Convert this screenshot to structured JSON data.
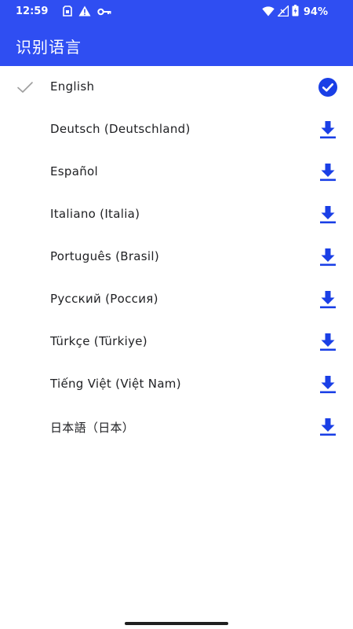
{
  "status_bar": {
    "time": "12:59",
    "left_icons": [
      "sim-icon",
      "warning-icon",
      "vpn-key-icon"
    ],
    "right_icons": [
      "wifi-icon",
      "cell-signal-icon",
      "battery-icon"
    ],
    "battery_percent": "94%"
  },
  "app_bar": {
    "title": "识别语言"
  },
  "languages": [
    {
      "label": "English",
      "selected": true,
      "status": "downloaded",
      "action_icon": "check-circle-icon"
    },
    {
      "label": "Deutsch (Deutschland)",
      "selected": false,
      "status": "available",
      "action_icon": "download-icon"
    },
    {
      "label": "Español",
      "selected": false,
      "status": "available",
      "action_icon": "download-icon"
    },
    {
      "label": "Italiano (Italia)",
      "selected": false,
      "status": "available",
      "action_icon": "download-icon"
    },
    {
      "label": "Português (Brasil)",
      "selected": false,
      "status": "available",
      "action_icon": "download-icon"
    },
    {
      "label": "Русский (Россия)",
      "selected": false,
      "status": "available",
      "action_icon": "download-icon"
    },
    {
      "label": "Türkçe (Türkiye)",
      "selected": false,
      "status": "available",
      "action_icon": "download-icon"
    },
    {
      "label": "Tiếng Việt (Việt Nam)",
      "selected": false,
      "status": "available",
      "action_icon": "download-icon"
    },
    {
      "label": "日本語（日本）",
      "selected": false,
      "status": "available",
      "action_icon": "download-icon"
    }
  ],
  "colors": {
    "primary": "#2f4ef2",
    "accent_icon": "#1a3fe6",
    "text": "#202124",
    "check_gray": "#9e9e9e"
  }
}
